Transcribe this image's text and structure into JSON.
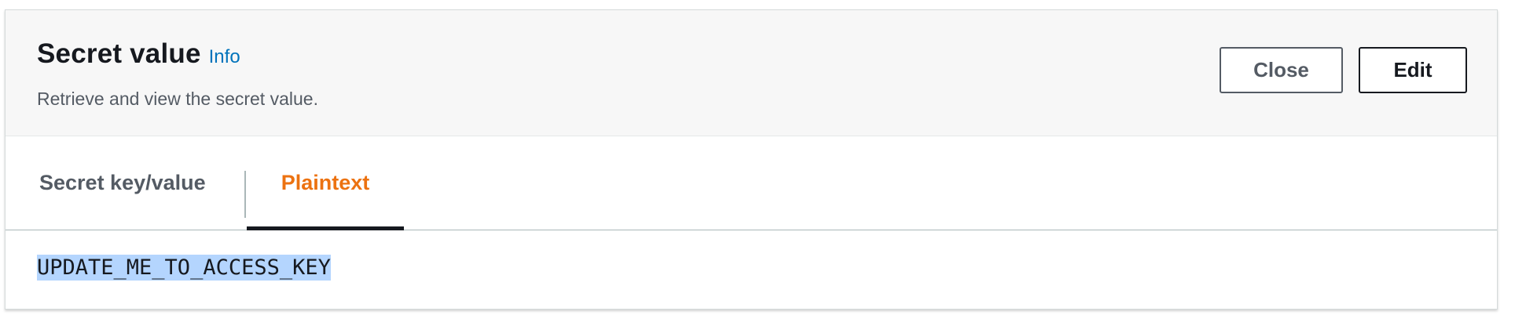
{
  "header": {
    "title": "Secret value",
    "info_link": "Info",
    "description": "Retrieve and view the secret value.",
    "close_label": "Close",
    "edit_label": "Edit"
  },
  "tabs": [
    {
      "label": "Secret key/value",
      "active": false
    },
    {
      "label": "Plaintext",
      "active": true
    }
  ],
  "content": {
    "plaintext_value": "UPDATE_ME_TO_ACCESS_KEY",
    "selected": true
  },
  "colors": {
    "active_tab": "#ec7211",
    "link": "#0073bb",
    "selection": "#b4d5fe"
  }
}
